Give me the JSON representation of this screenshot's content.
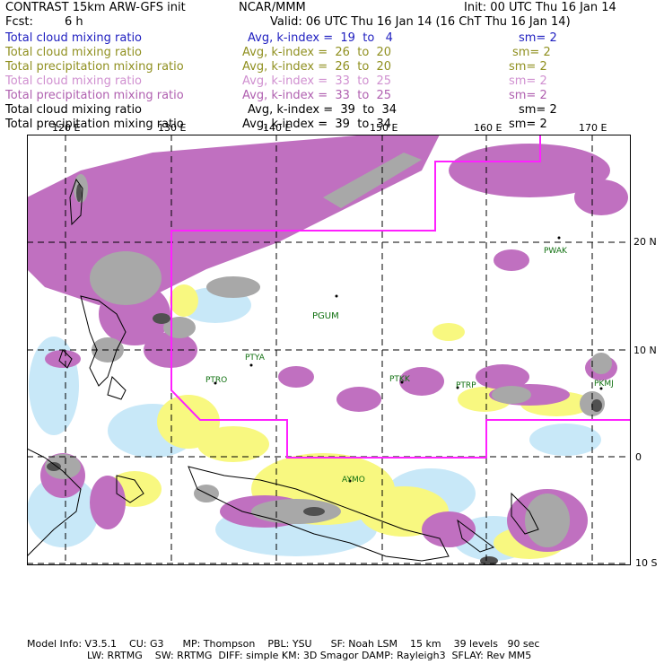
{
  "header": {
    "left_title": "CONTRAST 15km ARW-GFS init",
    "center_title": "NCAR/MMM",
    "init": "Init: 00 UTC Thu 16 Jan 14",
    "fcst_label": "Fcst:",
    "fcst_value": "6 h",
    "valid": "Valid: 06 UTC Thu 16 Jan 14 (16 ChT Thu 16 Jan 14)"
  },
  "fields": [
    {
      "name": "Total cloud mixing ratio",
      "avg": "Avg, k-index =  19  to   4",
      "sm": "sm= 2",
      "color": "#2020c0"
    },
    {
      "name": "Total cloud mixing ratio",
      "avg": "Avg, k-index =  26  to  20",
      "sm": "sm= 2",
      "color": "#909020"
    },
    {
      "name": "Total precipitation mixing ratio",
      "avg": "Avg, k-index =  26  to  20",
      "sm": "sm= 2",
      "color": "#909020"
    },
    {
      "name": "Total cloud mixing ratio",
      "avg": "Avg, k-index =  33  to  25",
      "sm": "sm= 2",
      "color": "#d090d0"
    },
    {
      "name": "Total precipitation mixing ratio",
      "avg": "Avg, k-index =  33  to  25",
      "sm": "sm= 2",
      "color": "#b060b0"
    },
    {
      "name": "Total cloud mixing ratio",
      "avg": "Avg, k-index =  39  to  34",
      "sm": "sm= 2",
      "color": "#000000"
    },
    {
      "name": "Total precipitation mixing ratio",
      "avg": "Avg, k-index =  39  to  34",
      "sm": "sm= 2",
      "color": "#000000"
    }
  ],
  "map": {
    "lon_labels": [
      "120 E",
      "130 E",
      "140 E",
      "150 E",
      "160 E",
      "170 E"
    ],
    "lat_labels": [
      "20 N",
      "10 N",
      "0",
      "10 S"
    ],
    "stations": [
      "PWAK",
      "PGUM",
      "PTYA",
      "PTRO",
      "PTKK",
      "PTRP",
      "PKMJ",
      "AYMO"
    ],
    "colors": {
      "light_blue": "#c8e8f8",
      "yellow": "#f8f880",
      "purple": "#c070c0",
      "gray": "#a8a8a8",
      "dark_gray": "#505050",
      "magenta_outline": "#ff20ff",
      "station_green": "#107010"
    }
  },
  "footer": {
    "line1": "Model Info: V3.5.1    CU: G3      MP: Thompson    PBL: YSU      SF: Noah LSM    15 km    39 levels   90 sec",
    "line2": "LW: RRTMG    SW: RRTMG  DIFF: simple KM: 3D Smagor DAMP: Rayleigh3  SFLAY: Rev MM5"
  }
}
